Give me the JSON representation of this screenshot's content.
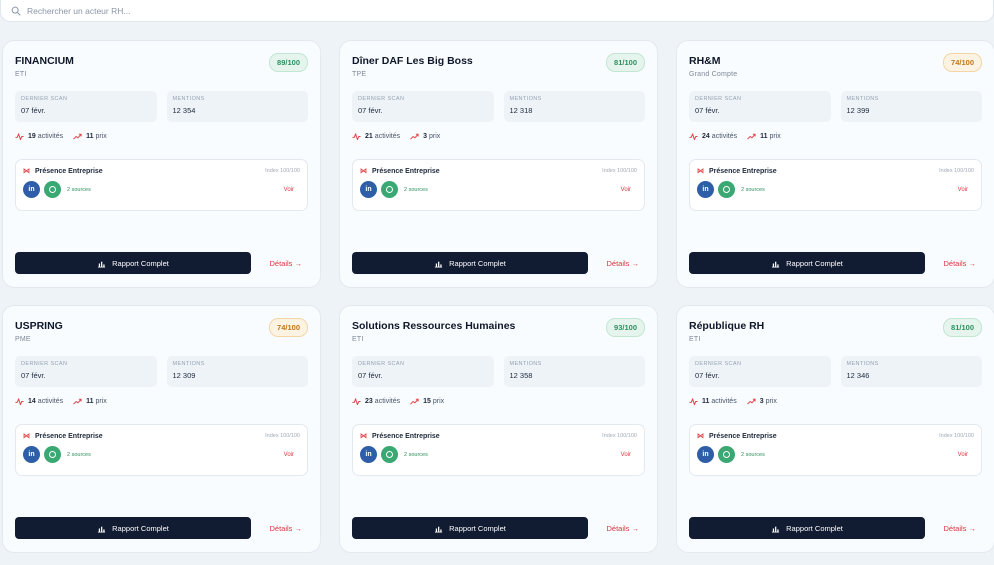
{
  "search": {
    "placeholder": "Rechercher un acteur RH..."
  },
  "labels": {
    "dernier_scan": "DERNIER SCAN",
    "mentions": "MENTIONS",
    "activites": "activités",
    "prix": "prix",
    "presence": "Présence Entreprise",
    "voir": "Voir",
    "report": "Rapport Complet",
    "details": "Détails →",
    "linkedin": "in"
  },
  "colors": {
    "accent_dark": "#111c33",
    "accent_red": "#d9363e",
    "score_green": "#2f8f5f",
    "score_orange": "#c2751a"
  },
  "cards": [
    {
      "name": "FINANCIUM",
      "category": "ETI",
      "score": "89/100",
      "score_tone": "green",
      "last_scan": "07 févr.",
      "mentions": "12 354",
      "activities": "19",
      "prices": "11",
      "index": "Index 100/100",
      "sources": "2 sources"
    },
    {
      "name": "Dîner DAF Les Big Boss",
      "category": "TPE",
      "score": "81/100",
      "score_tone": "green",
      "last_scan": "07 févr.",
      "mentions": "12 318",
      "activities": "21",
      "prices": "3",
      "index": "Index 100/100",
      "sources": "2 sources"
    },
    {
      "name": "RH&M",
      "category": "Grand Compte",
      "score": "74/100",
      "score_tone": "orange",
      "last_scan": "07 févr.",
      "mentions": "12 399",
      "activities": "24",
      "prices": "11",
      "index": "Index 100/100",
      "sources": "2 sources"
    },
    {
      "name": "USPRING",
      "category": "PME",
      "score": "74/100",
      "score_tone": "orange",
      "last_scan": "07 févr.",
      "mentions": "12 309",
      "activities": "14",
      "prices": "11",
      "index": "Index 100/100",
      "sources": "2 sources"
    },
    {
      "name": "Solutions Ressources Humaines",
      "category": "ETI",
      "score": "93/100",
      "score_tone": "green",
      "last_scan": "07 févr.",
      "mentions": "12 358",
      "activities": "23",
      "prices": "15",
      "index": "Index 100/100",
      "sources": "2 sources"
    },
    {
      "name": "République RH",
      "category": "ETI",
      "score": "81/100",
      "score_tone": "green",
      "last_scan": "07 févr.",
      "mentions": "12 346",
      "activities": "11",
      "prices": "3",
      "index": "Index 100/100",
      "sources": "2 sources"
    }
  ]
}
